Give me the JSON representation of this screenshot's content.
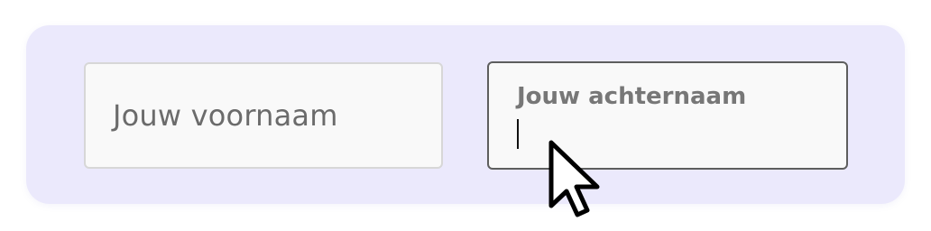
{
  "form": {
    "first_name": {
      "placeholder": "Jouw voornaam",
      "value": ""
    },
    "last_name": {
      "label": "Jouw achternaam",
      "value": "",
      "state": "focused"
    }
  },
  "colors": {
    "panel_background": "#ebe9fc",
    "field_background": "#f9f9f9",
    "field_border": "#d7d7d7",
    "field_border_focused": "#5e5e5e",
    "text": "#6b6b6b"
  },
  "pointer": {
    "icon": "arrow-cursor-icon"
  }
}
